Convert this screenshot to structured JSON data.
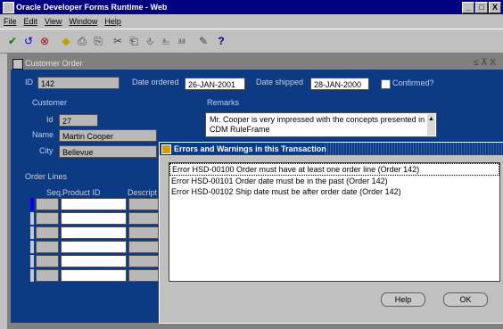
{
  "window": {
    "title": "Oracle Developer Forms Runtime - Web",
    "btn_min": "_",
    "btn_max": "□",
    "btn_close": "X"
  },
  "menu": [
    "File",
    "Edit",
    "View",
    "Window",
    "Help"
  ],
  "toolbar": [
    "✔",
    "↺",
    "⊗",
    "◆",
    "⎙",
    "⎘",
    "✂",
    "⎗",
    "⎀",
    "⎁",
    "⎂",
    "✎",
    "?"
  ],
  "form": {
    "title": "Customer Order",
    "controls": "≤ ⊼ X",
    "id_label": "ID",
    "id_value": "142",
    "date_ordered_label": "Date ordered",
    "date_ordered_value": "26-JAN-2001",
    "date_shipped_label": "Date shipped",
    "date_shipped_value": "28-JAN-2000",
    "confirmed_label": "Confirmed?",
    "customer_label": "Customer",
    "cust_id_label": "Id",
    "cust_id_value": "27",
    "name_label": "Name",
    "name_value": "Martin Cooper",
    "city_label": "City",
    "city_value": "Bellevue",
    "remarks_label": "Remarks",
    "remarks_value": "Mr. Cooper is very impressed with the concepts presented in CDM RuleFrame",
    "order_lines_label": "Order Lines",
    "col_seq": "Seq.",
    "col_product": "Product ID",
    "col_desc": "Descript"
  },
  "dialog": {
    "title": "Errors and Warnings in this Transaction",
    "errors": [
      "Error HSD-00100 Order must have at least one order line (Order 142)",
      "Error HSD-00101 Order date must be in the past (Order 142)",
      "Error HSD-00102 Ship date must be after order date (Order 142)"
    ],
    "help_label": "Help",
    "ok_label": "OK"
  }
}
